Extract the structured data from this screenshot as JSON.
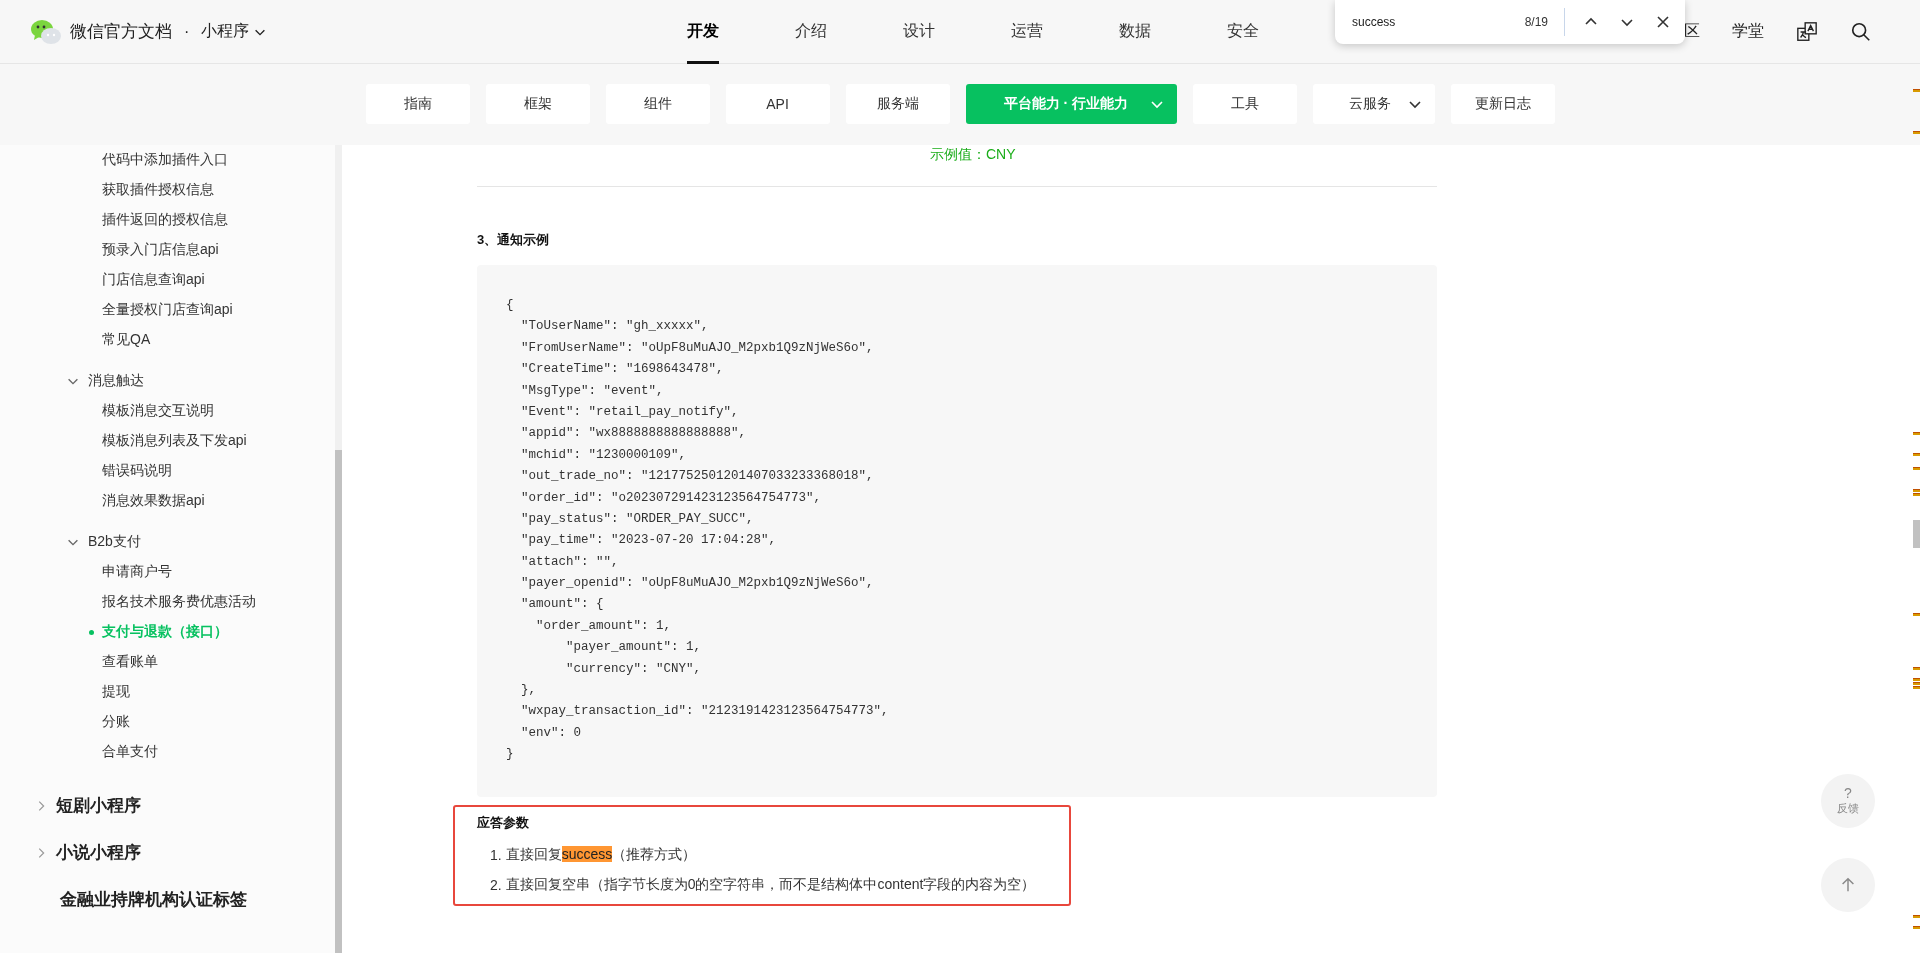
{
  "header": {
    "logo_title": "微信官方文档",
    "separator": "·",
    "product": "小程序",
    "nav": [
      {
        "label": "开发",
        "selected": true
      },
      {
        "label": "介绍",
        "selected": false
      },
      {
        "label": "设计",
        "selected": false
      },
      {
        "label": "运营",
        "selected": false
      },
      {
        "label": "数据",
        "selected": false
      },
      {
        "label": "安全",
        "selected": false
      }
    ],
    "right_links": [
      "区",
      "学堂"
    ]
  },
  "find_bar": {
    "query": "success",
    "count": "8/19"
  },
  "subnav": [
    {
      "label": "指南",
      "selected": false,
      "has_menu": false
    },
    {
      "label": "框架",
      "selected": false,
      "has_menu": false
    },
    {
      "label": "组件",
      "selected": false,
      "has_menu": false
    },
    {
      "label": "API",
      "selected": false,
      "has_menu": false
    },
    {
      "label": "服务端",
      "selected": false,
      "has_menu": false
    },
    {
      "label": "平台能力 · 行业能力",
      "selected": true,
      "has_menu": true
    },
    {
      "label": "工具",
      "selected": false,
      "has_menu": false
    },
    {
      "label": "云服务",
      "selected": false,
      "has_menu": true
    },
    {
      "label": "更新日志",
      "selected": false,
      "has_menu": false
    }
  ],
  "sidebar": {
    "items": [
      {
        "children": [
          {
            "children": [
              {
                "label": "代码中添加插件入口",
                "selected": false
              },
              {
                "label": "获取插件授权信息",
                "selected": false
              },
              {
                "label": "插件返回的授权信息",
                "selected": false
              },
              {
                "label": "预录入门店信息api",
                "selected": false
              },
              {
                "label": "门店信息查询api",
                "selected": false
              },
              {
                "label": "全量授权门店查询api",
                "selected": false
              },
              {
                "label": "常见QA",
                "selected": false
              }
            ]
          },
          {
            "label": "消息触达",
            "selected": false,
            "expanded": true,
            "children": [
              {
                "label": "模板消息交互说明",
                "selected": false
              },
              {
                "label": "模板消息列表及下发api",
                "selected": false
              },
              {
                "label": "错误码说明",
                "selected": false
              },
              {
                "label": "消息效果数据api",
                "selected": false
              }
            ]
          },
          {
            "label": "B2b支付",
            "selected": false,
            "expanded": true,
            "children": [
              {
                "label": "申请商户号",
                "selected": false
              },
              {
                "label": "报名技术服务费优惠活动",
                "selected": false
              },
              {
                "label": "支付与退款（接口）",
                "selected": true
              },
              {
                "label": "查看账单",
                "selected": false
              },
              {
                "label": "提现",
                "selected": false
              },
              {
                "label": "分账",
                "selected": false
              },
              {
                "label": "合单支付",
                "selected": false
              }
            ]
          }
        ]
      },
      {
        "label": "短剧小程序",
        "selected": false,
        "expanded": false
      },
      {
        "label": "小说小程序",
        "selected": false,
        "expanded": false
      },
      {
        "label": "金融业持牌机构认证标签",
        "selected": false
      }
    ]
  },
  "content": {
    "table_row": {
      "description": "示例值：CNY"
    },
    "heading": "3、通知示例",
    "code_lines": [
      "{",
      "  \"ToUserName\": \"gh_xxxxx\",",
      "  \"FromUserName\": \"oUpF8uMuAJO_M2pxb1Q9zNjWeS6o\",",
      "  \"CreateTime\": \"1698643478\",",
      "  \"MsgType\": \"event\",",
      "  \"Event\": \"retail_pay_notify\",",
      "  \"appid\": \"wx8888888888888888\",",
      "  \"mchid\": \"1230000109\",",
      "  \"out_trade_no\": \"1217752501201407033233368018\",",
      "  \"order_id\": \"o202307291423123564754773\",",
      "  \"pay_status\": \"ORDER_PAY_SUCC\",",
      "  \"pay_time\": \"2023-07-20 17:04:28\",",
      "  \"attach\": \"\",",
      "  \"payer_openid\": \"oUpF8uMuAJO_M2pxb1Q9zNjWeS6o\",",
      "  \"amount\": {",
      "    \"order_amount\": 1,",
      "        \"payer_amount\": 1,",
      "        \"currency\": \"CNY\",",
      "  },",
      "  \"wxpay_transaction_id\": \"2123191423123564754773\",",
      "  \"env\": 0",
      "}"
    ],
    "response": {
      "title": "应答参数",
      "items": [
        {
          "number": "1.",
          "segments": [
            {
              "text": "直接回复",
              "highlighted": false
            },
            {
              "text": "success",
              "highlighted": true
            },
            {
              "text": "（推荐方式）",
              "highlighted": false
            }
          ]
        },
        {
          "number": "2.",
          "segments": [
            {
              "text": "直接回复空串（指字节长度为0的空字符串，而不是结构体中content字段的内容为空）",
              "highlighted": false
            }
          ]
        }
      ]
    }
  },
  "float_buttons": {
    "feedback": {
      "icon": "?",
      "label": "反馈"
    }
  }
}
